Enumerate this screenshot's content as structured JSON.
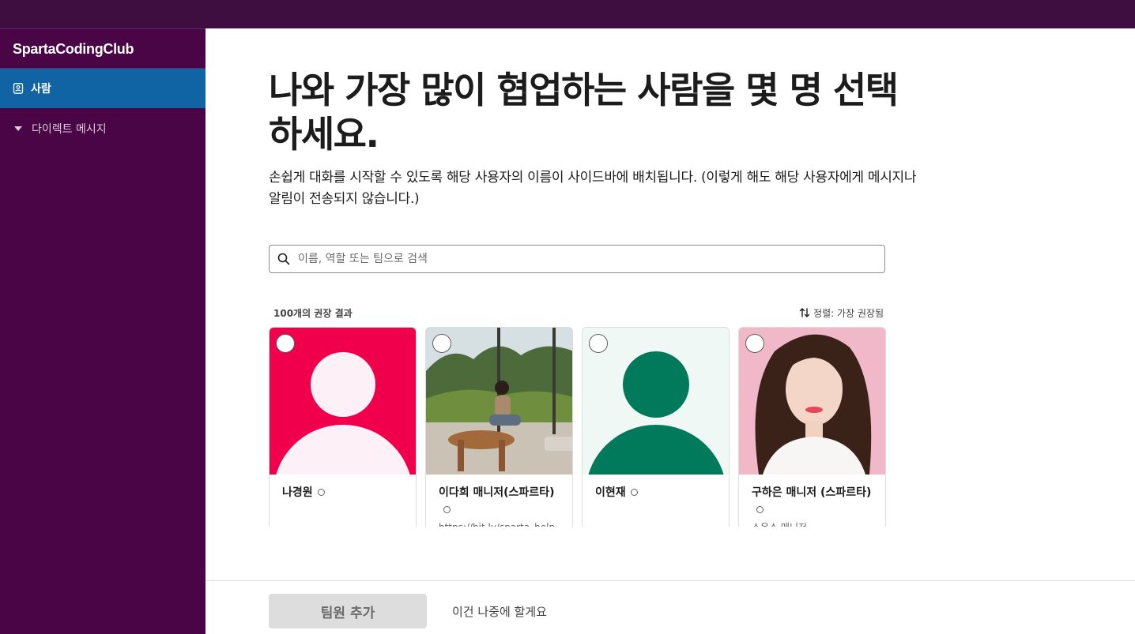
{
  "sidebar": {
    "workspace": "SpartaCodingClub",
    "active_item": "사람",
    "section": "다이렉트 메시지"
  },
  "main": {
    "heading": "나와 가장 많이 협업하는 사람을 몇 명 선택하세요.",
    "subtext": "손쉽게 대화를 시작할 수 있도록 해당 사용자의 이름이 사이드바에 배치됩니다. (이렇게 해도 해당 사용자에게 메시지나 알림이 전송되지 않습니다.)",
    "search_placeholder": "이름, 역할 또는 팀으로 검색",
    "results_count": "100개의 권장 결과",
    "sort_label": "정렬: 가장 권장됨",
    "people": [
      {
        "name": "나경원",
        "subtitle": "",
        "avatar": "default-avatar-pink"
      },
      {
        "name": "이다희 매니저(스파르타)",
        "subtitle": "https://bit.ly/sparta_help",
        "avatar": "photo"
      },
      {
        "name": "이현재",
        "subtitle": "",
        "avatar": "default-avatar-green"
      },
      {
        "name": "구하은 매니저 (스파르타)",
        "subtitle": "스온스 매니저",
        "avatar": "photo"
      }
    ]
  },
  "footer": {
    "add_button": "팀원 추가",
    "later_link": "이건 나중에 할게요"
  },
  "colors": {
    "topbar": "#3f0e40",
    "sidebar": "#4a0546",
    "active": "#1164a3",
    "pink_avatar": "#f0004c",
    "green_avatar": "#007a5a"
  }
}
